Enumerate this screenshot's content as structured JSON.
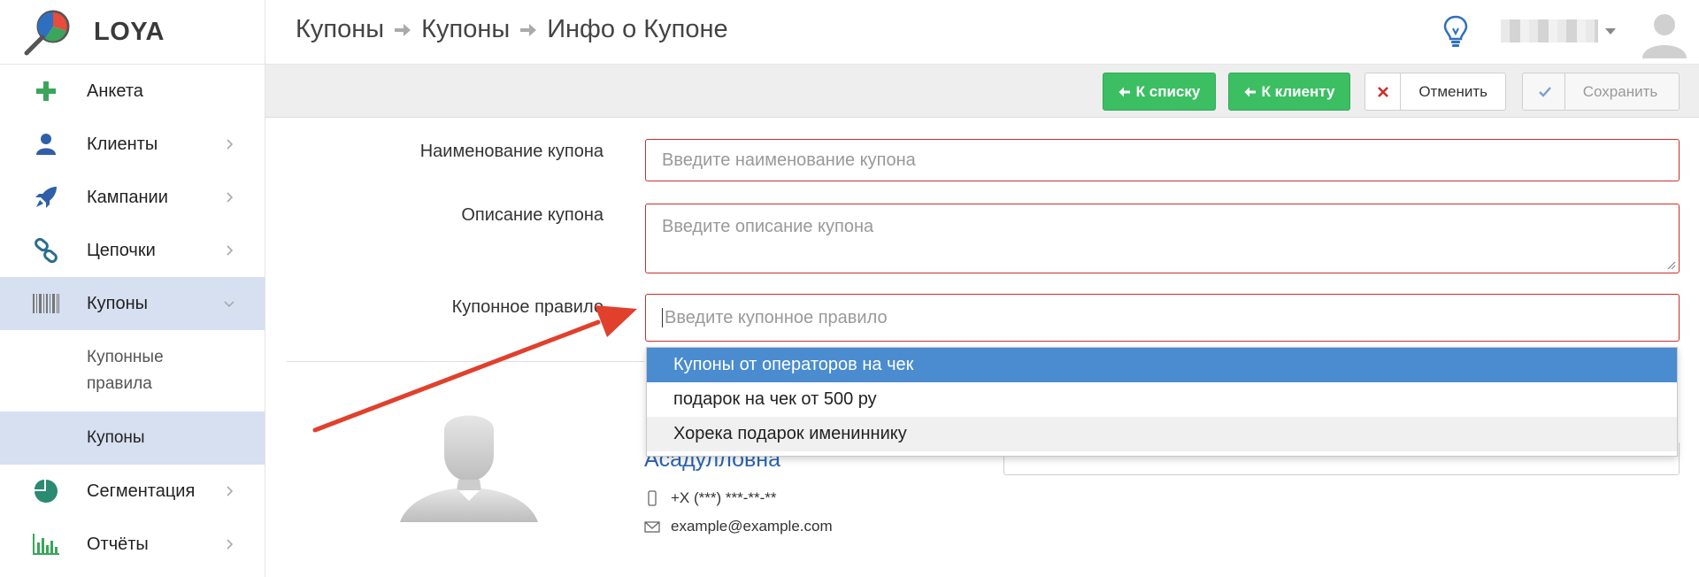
{
  "app": {
    "name": "LOYA"
  },
  "breadcrumb": [
    "Купоны",
    "Купоны",
    "Инфо о Купоне"
  ],
  "sidebar": {
    "items": [
      {
        "label": "Анкета",
        "icon": "plus-icon"
      },
      {
        "label": "Клиенты",
        "icon": "user-icon"
      },
      {
        "label": "Кампании",
        "icon": "rocket-icon"
      },
      {
        "label": "Цепочки",
        "icon": "link-icon"
      },
      {
        "label": "Купоны",
        "icon": "barcode-icon"
      },
      {
        "label": "Сегментация",
        "icon": "pie-chart-icon"
      },
      {
        "label": "Отчёты",
        "icon": "bar-chart-icon"
      }
    ],
    "subitems": [
      {
        "label": "Купонные правила"
      },
      {
        "label": "Купоны"
      }
    ]
  },
  "toolbar": {
    "to_list": "К списку",
    "to_client": "К клиенту",
    "cancel": "Отменить",
    "save": "Сохранить"
  },
  "form": {
    "name_label": "Наименование купона",
    "name_placeholder": "Введите наименование купона",
    "desc_label": "Описание купона",
    "desc_placeholder": "Введите описание купона",
    "rule_label": "Купонное правило",
    "rule_placeholder": "Введите купонное правило"
  },
  "dropdown": {
    "options": [
      "Купоны от операторов на чек",
      "подарок на чек от 500 ру",
      "Хорека подарок имениннику"
    ]
  },
  "client": {
    "name": "Асадулловна",
    "phone": "+X (***) ***-**-**",
    "email": "example@example.com"
  },
  "colors": {
    "accent_green": "#3cbf63",
    "error_red": "#c9302c",
    "selected_blue": "#4a8ccf",
    "active_nav": "#d7e0f1",
    "arrow_red": "#e0402c"
  }
}
